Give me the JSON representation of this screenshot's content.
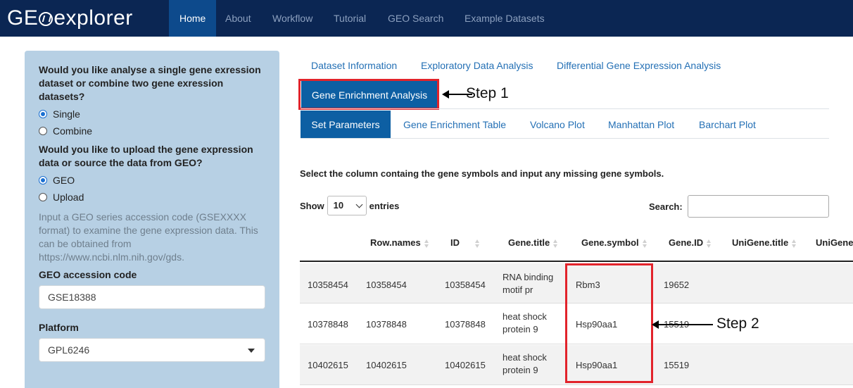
{
  "navbar": {
    "brand_prefix": "GE",
    "brand_suffix": "explorer",
    "items": [
      {
        "label": "Home",
        "active": true
      },
      {
        "label": "About"
      },
      {
        "label": "Workflow"
      },
      {
        "label": "Tutorial"
      },
      {
        "label": "GEO Search"
      },
      {
        "label": "Example Datasets"
      }
    ],
    "bg_color": "#0b2653",
    "active_color": "#0d4a8c"
  },
  "sidebar": {
    "q1": "Would you like analyse a single gene exression dataset or combine two gene exression datasets?",
    "q1_options": [
      "Single",
      "Combine"
    ],
    "q1_selected": "Single",
    "q2": "Would you like to upload the gene expression data or source the data from GEO?",
    "q2_options": [
      "GEO",
      "Upload"
    ],
    "q2_selected": "GEO",
    "help": "Input a GEO series accession code (GSEXXXX format) to examine the gene expression data. This can be obtained from https://www.ncbi.nlm.nih.gov/gds.",
    "geo_label": "GEO accession code",
    "geo_value": "GSE18388",
    "platform_label": "Platform",
    "platform_value": "GPL6246",
    "bg_color": "#b7d0e4"
  },
  "main": {
    "tabs": [
      "Dataset Information",
      "Exploratory Data Analysis",
      "Differential Gene Expression Analysis",
      "Gene Enrichment Analysis"
    ],
    "active_tab": "Gene Enrichment Analysis",
    "subtabs": [
      "Set Parameters",
      "Gene Enrichment Table",
      "Volcano Plot",
      "Manhattan Plot",
      "Barchart Plot"
    ],
    "active_subtab": "Set Parameters",
    "instruction": "Select the column containg the gene symbols and input any missing gene symbols.",
    "show_label": "Show",
    "entries_value": "10",
    "entries_label": "entries",
    "search_label": "Search:",
    "columns": [
      "Row.names",
      "ID",
      "Gene.title",
      "Gene.symbol",
      "Gene.ID",
      "UniGene.title",
      "UniGene"
    ],
    "rows": [
      {
        "index": "10358454",
        "row_names": "10358454",
        "id": "10358454",
        "gene_title": "RNA binding motif pr",
        "gene_symbol": "Rbm3",
        "gene_id": "19652"
      },
      {
        "index": "10378848",
        "row_names": "10378848",
        "id": "10378848",
        "gene_title": "heat shock protein 9",
        "gene_symbol": "Hsp90aa1",
        "gene_id": "15519"
      },
      {
        "index": "10402615",
        "row_names": "10402615",
        "id": "10402615",
        "gene_title": "heat shock protein 9",
        "gene_symbol": "Hsp90aa1",
        "gene_id": "15519"
      }
    ]
  },
  "annotations": {
    "step1": "Step 1",
    "step2": "Step 2",
    "highlight_color": "#e2232b"
  }
}
